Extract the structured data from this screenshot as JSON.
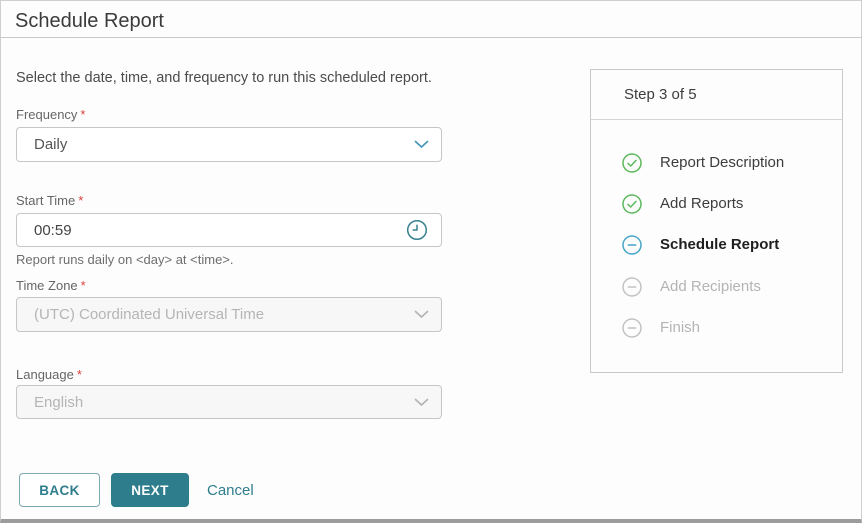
{
  "page": {
    "title": "Schedule Report",
    "intro": "Select the date, time, and frequency to run this scheduled report."
  },
  "form": {
    "required_marker": "*",
    "frequency": {
      "label": "Frequency",
      "value": "Daily",
      "disabled": false
    },
    "start_time": {
      "label": "Start Time",
      "value": "00:59",
      "helper": "Report runs daily on <day> at <time>.",
      "disabled": false
    },
    "time_zone": {
      "label": "Time Zone",
      "value": "(UTC) Coordinated Universal Time",
      "disabled": true
    },
    "language": {
      "label": "Language",
      "value": "English",
      "disabled": true
    }
  },
  "actions": {
    "back": "BACK",
    "next": "NEXT",
    "cancel": "Cancel"
  },
  "wizard": {
    "header": "Step 3 of 5",
    "steps": [
      {
        "label": "Report Description",
        "state": "completed"
      },
      {
        "label": "Add Reports",
        "state": "completed"
      },
      {
        "label": "Schedule Report",
        "state": "current"
      },
      {
        "label": "Add Recipients",
        "state": "pending"
      },
      {
        "label": "Finish",
        "state": "pending"
      }
    ]
  },
  "colors": {
    "teal_primary": "#2e7d8c",
    "chevron_teal": "#4796b3",
    "chevron_disabled": "#b3b3b3",
    "step_completed_green": "#5cb85c",
    "step_current_blue": "#45a5c9",
    "step_pending_gray": "#c2c2c2",
    "required_red": "#d9433e",
    "bottom_bar_gray": "#9c9c9c"
  }
}
